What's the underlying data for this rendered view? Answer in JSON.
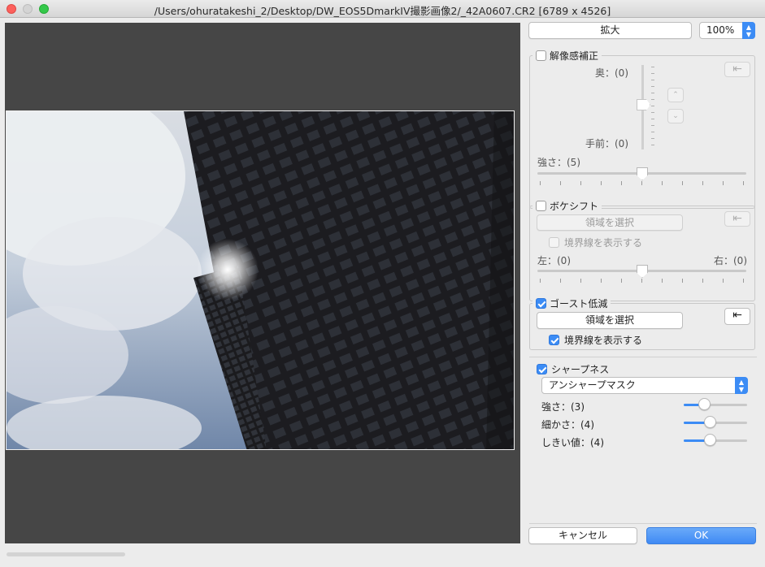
{
  "window": {
    "title": "/Users/ohuratakeshi_2/Desktop/DW_EOS5DmarkIV撮影画像2/_42A0607.CR2 [6789 x 4526]"
  },
  "toolbar": {
    "zoom_button": "拡大",
    "zoom_value": "100%"
  },
  "dpo": {
    "title": "解像感補正",
    "checked": false,
    "back_label": "奥：(0)",
    "front_label": "手前：(0)",
    "strength_label": "強さ：(5)",
    "strength": 5
  },
  "bokeh": {
    "title": "ボケシフト",
    "checked": false,
    "select_area": "領域を選択",
    "show_border": "境界線を表示する",
    "left_label": "左：(0)",
    "right_label": "右：(0)"
  },
  "ghost": {
    "title": "ゴースト低減",
    "checked": true,
    "select_area": "領域を選択",
    "show_border": "境界線を表示する",
    "show_border_checked": true
  },
  "sharpness": {
    "title": "シャープネス",
    "checked": true,
    "mode": "アンシャープマスク",
    "strength_label": "強さ：(3)",
    "strength": 3,
    "fineness_label": "細かさ：(4)",
    "fineness": 4,
    "threshold_label": "しきい値：(4)",
    "threshold": 4
  },
  "footer": {
    "cancel": "キャンセル",
    "ok": "OK"
  },
  "colors": {
    "accent": "#3c8cf5",
    "viewer_bg": "#464646"
  }
}
